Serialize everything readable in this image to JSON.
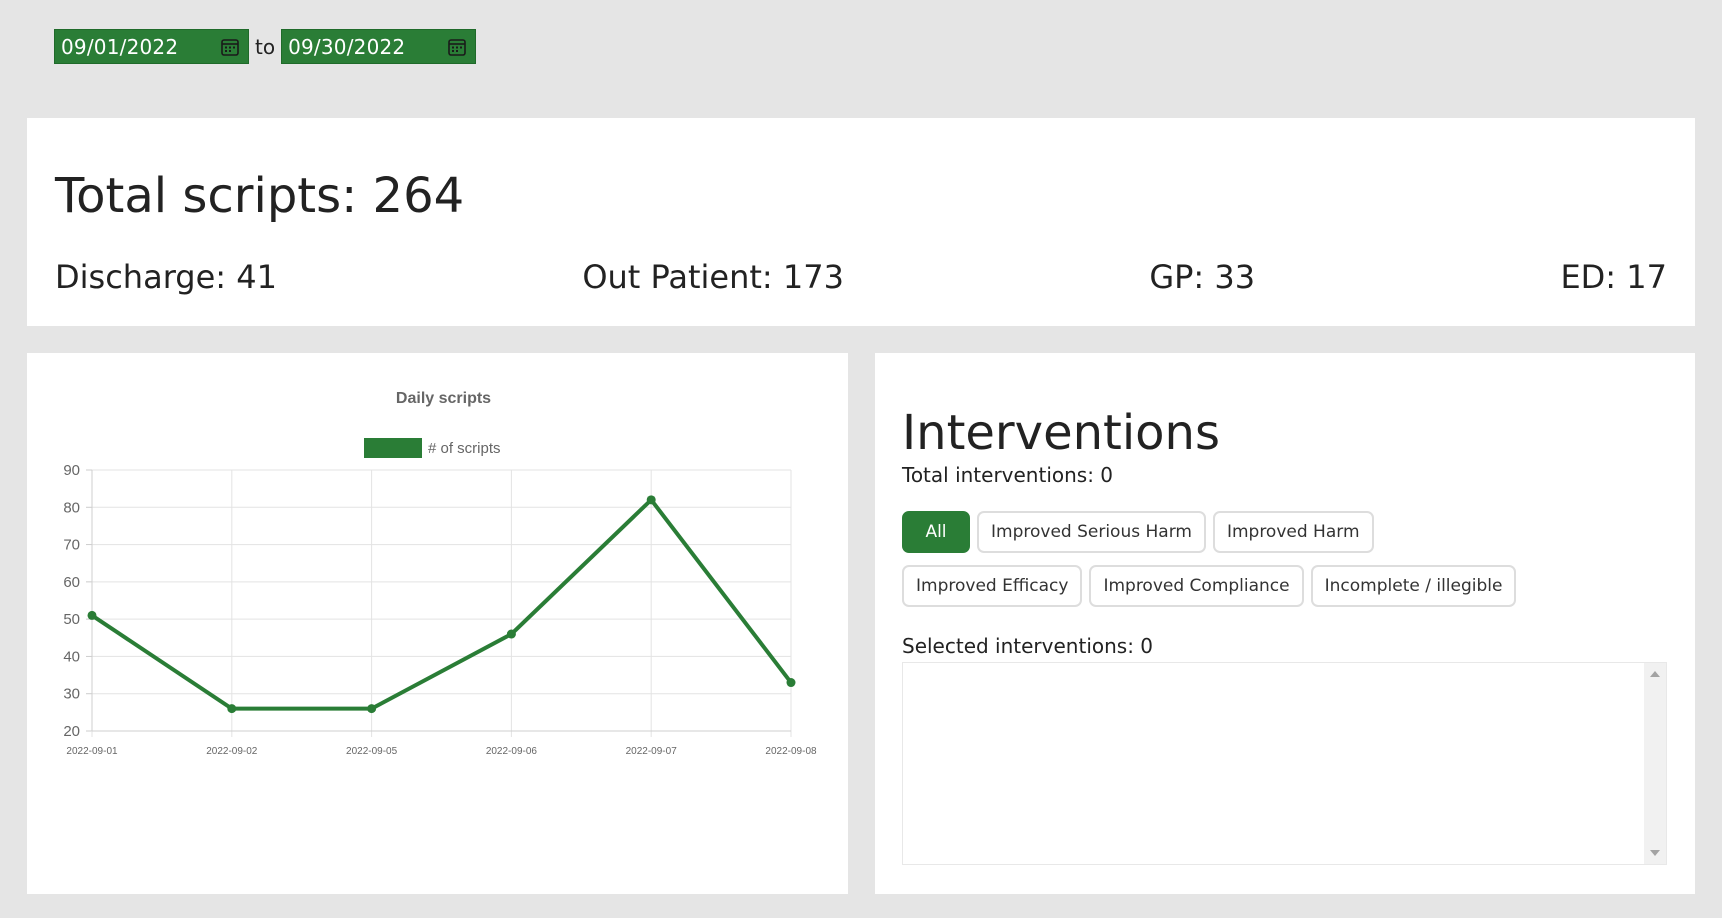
{
  "date_range": {
    "start": "09/01/2022",
    "end": "09/30/2022",
    "separator": "to"
  },
  "summary": {
    "total": "Total scripts: 264",
    "stats": [
      {
        "label": "Discharge: 41"
      },
      {
        "label": "Out Patient: 173"
      },
      {
        "label": "GP: 33"
      },
      {
        "label": "ED: 17"
      }
    ]
  },
  "chart_data": {
    "type": "line",
    "title": "Daily scripts",
    "categories": [
      "2022-09-01",
      "2022-09-02",
      "2022-09-05",
      "2022-09-06",
      "2022-09-07",
      "2022-09-08"
    ],
    "series": [
      {
        "name": "# of scripts",
        "values": [
          51,
          26,
          26,
          46,
          82,
          33
        ]
      }
    ],
    "ylim": [
      20,
      90
    ],
    "yticks": [
      20,
      30,
      40,
      50,
      60,
      70,
      80,
      90
    ],
    "grid": true,
    "legend": "top",
    "color": "#2a7d36"
  },
  "interventions": {
    "title": "Interventions",
    "total": "Total interventions: 0",
    "filters": [
      "All",
      "Improved Serious Harm",
      "Improved Harm",
      "Improved Efficacy",
      "Improved Compliance",
      "Incomplete / illegible"
    ],
    "active_filter": "All",
    "selected": "Selected interventions: 0"
  },
  "colors": {
    "accent": "#2a7d36",
    "background": "#e5e5e5"
  }
}
